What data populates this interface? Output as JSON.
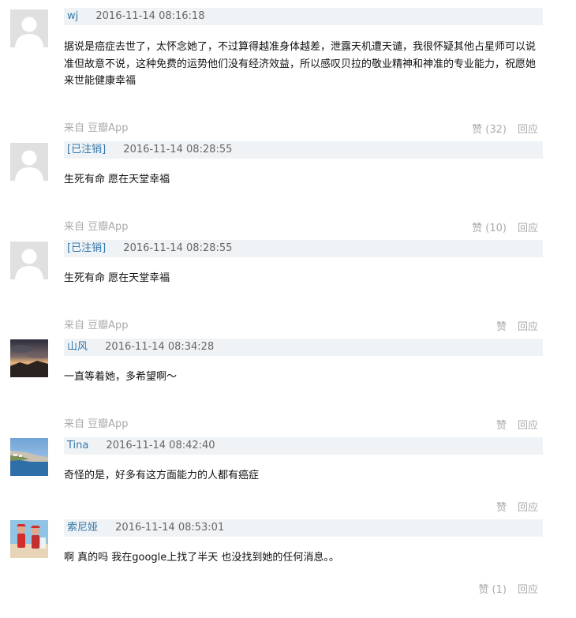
{
  "comments": [
    {
      "author": "wj",
      "time": "2016-11-14 08:16:18",
      "text": "据说是癌症去世了，太怀念她了，不过算得越准身体越差，泄露天机遭天谴，我很怀疑其他占星师可以说准但故意不说，这种免费的运势他们没有经济效益，所以感叹贝拉的敬业精神和神准的专业能力，祝愿她来世能健康幸福",
      "source": "来自 豆瓣App",
      "like": "赞 (32)",
      "reply": "回应",
      "avatar": "default-avatar-icon"
    },
    {
      "author": "[已注销]",
      "time": "2016-11-14 08:28:55",
      "text": "生死有命 愿在天堂幸福",
      "source": "来自 豆瓣App",
      "like": "赞 (10)",
      "reply": "回应",
      "avatar": "default-avatar-icon"
    },
    {
      "author": "[已注销]",
      "time": "2016-11-14 08:28:55",
      "text": "生死有命 愿在天堂幸福",
      "source": "来自 豆瓣App",
      "like": "赞",
      "reply": "回应",
      "avatar": "default-avatar-icon"
    },
    {
      "author": "山风",
      "time": "2016-11-14 08:34:28",
      "text": "一直等着她，多希望啊～",
      "source": "来自 豆瓣App",
      "like": "赞",
      "reply": "回应",
      "avatar": "sunset-landscape-avatar"
    },
    {
      "author": "Tina",
      "time": "2016-11-14 08:42:40",
      "text": "奇怪的是，好多有这方面能力的人都有癌症",
      "source": "",
      "like": "赞",
      "reply": "回应",
      "avatar": "seaside-town-avatar"
    },
    {
      "author": "索尼娅",
      "time": "2016-11-14 08:53:01",
      "text": "啊 真的吗 我在google上找了半天 也没找到她的任何消息。。",
      "source": "",
      "like": "赞 (1)",
      "reply": "回应",
      "avatar": "red-figures-avatar"
    }
  ],
  "colors": {
    "author_link": "#3377aa",
    "meta_bg": "#f0f3f5",
    "muted": "#aaaaaa"
  }
}
